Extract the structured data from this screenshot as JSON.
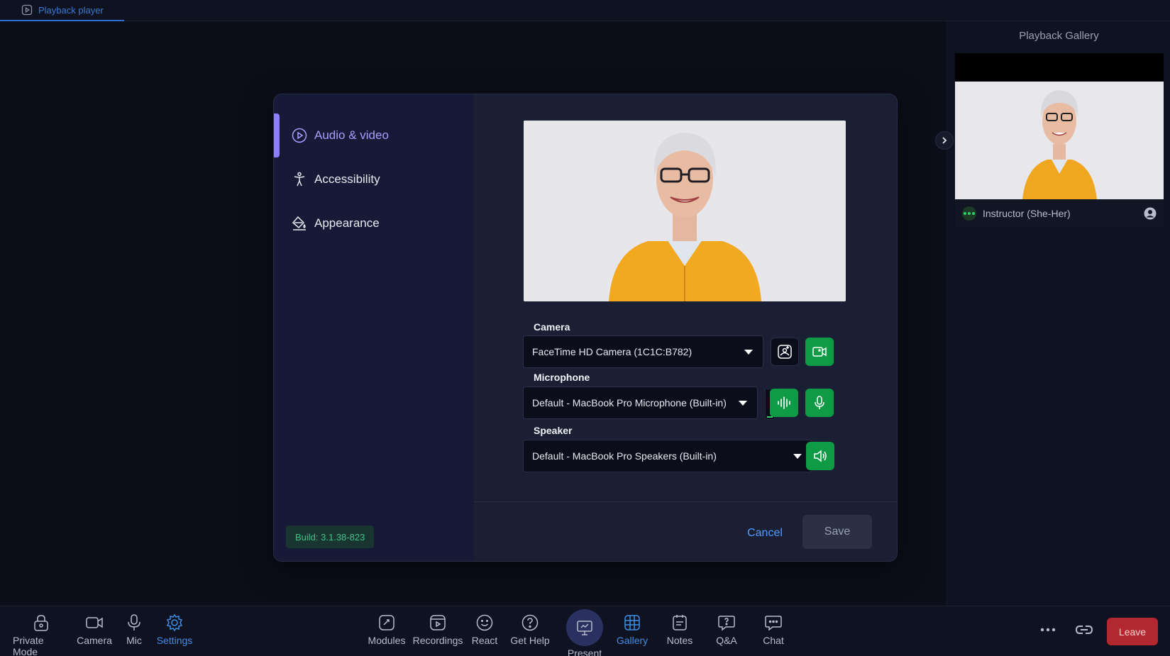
{
  "top_tab": {
    "label": "Playback player"
  },
  "gallery": {
    "title": "Playback Gallery",
    "participant_name": "Instructor (She-Her)"
  },
  "settings_nav": {
    "items": [
      {
        "label": "Audio & video",
        "icon": "play-circle-icon",
        "active": true
      },
      {
        "label": "Accessibility",
        "icon": "accessibility-icon",
        "active": false
      },
      {
        "label": "Appearance",
        "icon": "paint-bucket-icon",
        "active": false
      }
    ],
    "build": "Build: 3.1.38-823"
  },
  "devices": {
    "camera_label": "Camera",
    "camera_value": "FaceTime HD Camera (1C1C:B782)",
    "microphone_label": "Microphone",
    "microphone_value": "Default - MacBook Pro Microphone (Built-in)",
    "speaker_label": "Speaker",
    "speaker_value": "Default - MacBook Pro Speakers (Built-in)",
    "mic_level": 0.05
  },
  "actions": {
    "cancel": "Cancel",
    "save": "Save"
  },
  "toolbar": {
    "left": [
      {
        "label": "Private Mode",
        "icon": "lock-icon"
      },
      {
        "label": "Camera",
        "icon": "camera-icon"
      },
      {
        "label": "Mic",
        "icon": "mic-icon"
      },
      {
        "label": "Settings",
        "icon": "gear-icon",
        "active": true
      }
    ],
    "center": [
      {
        "label": "Modules",
        "icon": "modules-icon"
      },
      {
        "label": "Recordings",
        "icon": "recordings-icon"
      },
      {
        "label": "React",
        "icon": "smile-icon"
      },
      {
        "label": "Get Help",
        "icon": "help-icon"
      },
      {
        "label": "Present",
        "icon": "present-icon"
      },
      {
        "label": "Gallery",
        "icon": "grid-icon",
        "active": true
      },
      {
        "label": "Notes",
        "icon": "notes-icon"
      },
      {
        "label": "Q&A",
        "icon": "qa-icon"
      },
      {
        "label": "Chat",
        "icon": "chat-icon"
      }
    ],
    "leave": "Leave"
  },
  "colors": {
    "accent_purple": "#8d7dff",
    "accent_blue": "#3f8fe8",
    "green": "#0f9a45",
    "leave_red": "#b3282f"
  }
}
